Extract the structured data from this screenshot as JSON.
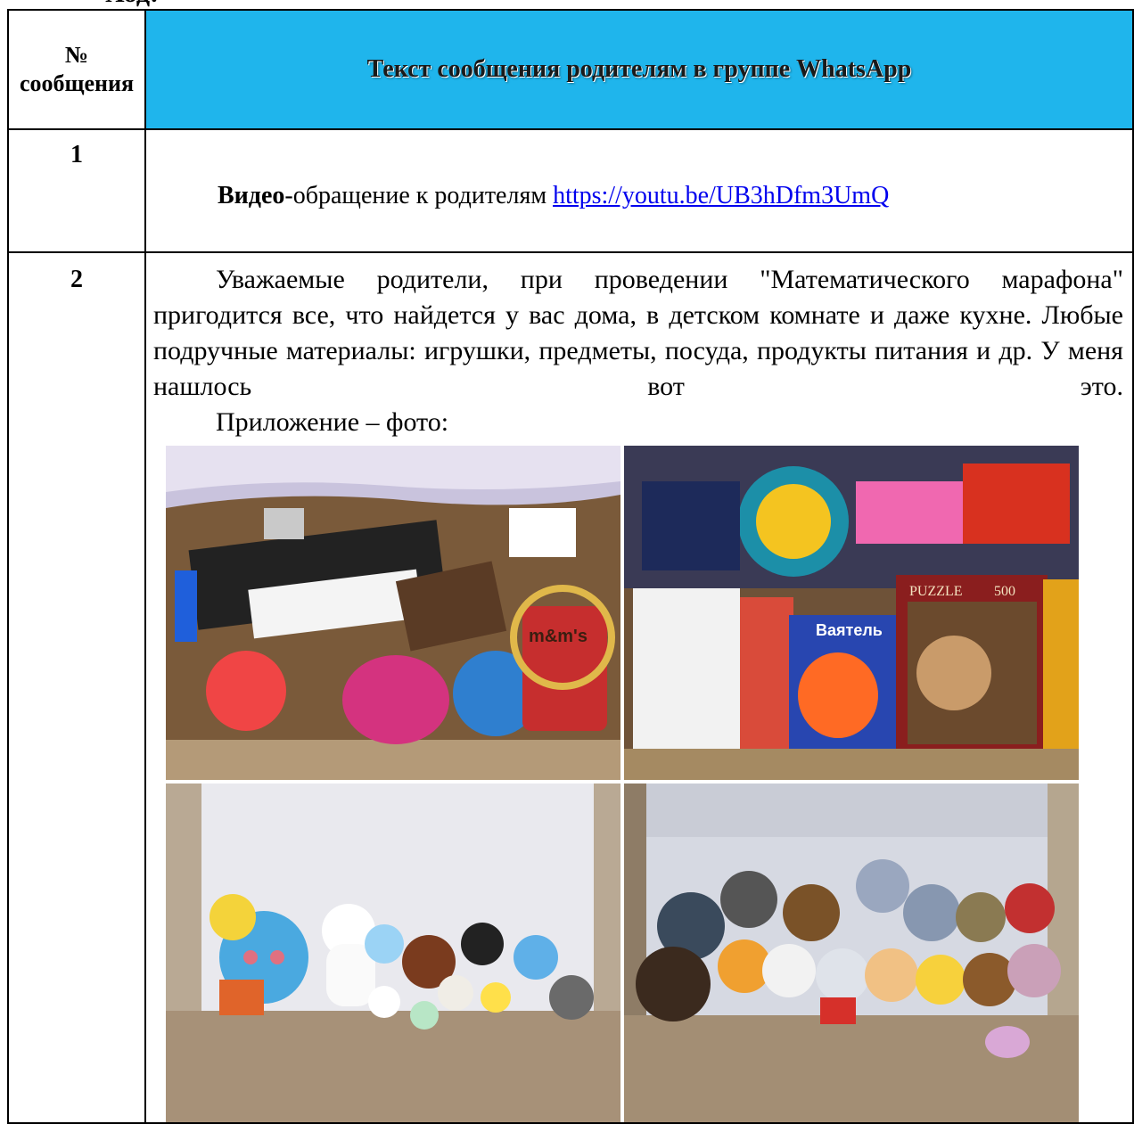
{
  "page_fragment_top": "Ход:",
  "table": {
    "header": {
      "number_label": "№ сообщения",
      "text_label": "Текст сообщения родителям в группе WhatsApp"
    },
    "rows": [
      {
        "number": "1",
        "bold_prefix": "Видео",
        "text_after_prefix": "-обращение к родителям ",
        "link_text": "https://youtu.be/UB3hDfm3UmQ"
      },
      {
        "number": "2",
        "paragraph": "Уважаемые родители, при проведении \"Математического марафона\" пригодится все, что найдется у вас дома, в детском комнате и даже кухне. Любые подручные материалы: игрушки, предметы, посуда, продукты питания и др. У меня нашлось вот это.",
        "attachment_label": "Приложение – фото:"
      }
    ]
  },
  "photo_texts": {
    "puzzle": "PUZZLE",
    "puzzle_count": "500",
    "mm": "m&m's",
    "vayatel": "Ваятель"
  },
  "colors": {
    "header_blue": "#1fb5ec",
    "link": "#0000ee"
  }
}
